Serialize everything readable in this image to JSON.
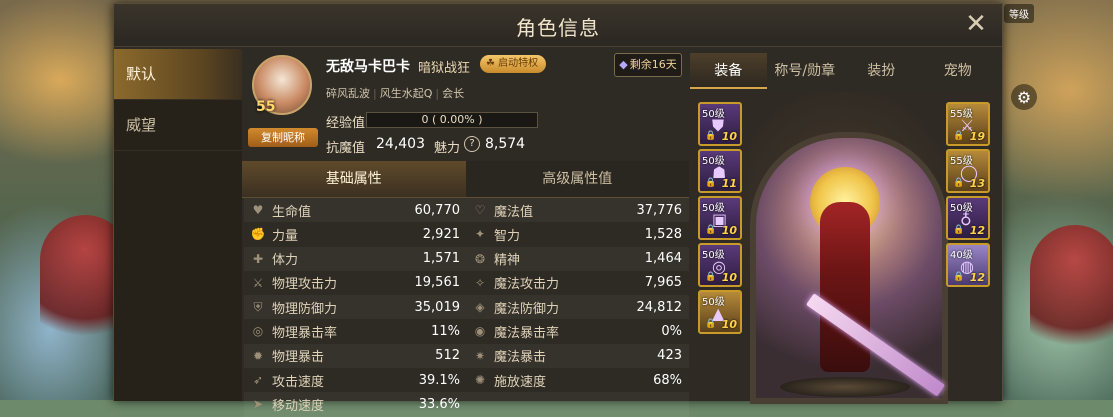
{
  "dialog": {
    "title": "角色信息",
    "close_icon": "close-icon"
  },
  "background": {
    "badge_text": "等级"
  },
  "side_nav": [
    {
      "label": "默认",
      "active": true
    },
    {
      "label": "威望",
      "active": false
    }
  ],
  "profile": {
    "level": "55",
    "copy_name_label": "复制昵称",
    "name": "无敌马卡巴卡",
    "title": "暗狱战狂",
    "privilege_label": "启动特权",
    "remaining_label": "剩余16天",
    "guild_name": "碎风乱波",
    "guild_server": "风生水起Q",
    "guild_role": "会长",
    "exp_label": "经验值",
    "exp_value": "0 ( 0.00% )",
    "exp_fraction": 0,
    "magic_resist_label": "抗魔值",
    "magic_resist_value": "24,403",
    "charm_label": "魅力",
    "charm_help": "?",
    "charm_value": "8,574"
  },
  "attr_tabs": [
    {
      "label": "基础属性",
      "active": true
    },
    {
      "label": "高级属性值",
      "active": false
    }
  ],
  "attributes": [
    [
      {
        "icon": "heart-icon",
        "label": "生命值",
        "value": "60,770"
      },
      {
        "icon": "magic-heart-icon",
        "label": "魔法值",
        "value": "37,776"
      }
    ],
    [
      {
        "icon": "strength-icon",
        "label": "力量",
        "value": "2,921"
      },
      {
        "icon": "intelligence-icon",
        "label": "智力",
        "value": "1,528"
      }
    ],
    [
      {
        "icon": "stamina-icon",
        "label": "体力",
        "value": "1,571"
      },
      {
        "icon": "spirit-icon",
        "label": "精神",
        "value": "1,464"
      }
    ],
    [
      {
        "icon": "sword-icon",
        "label": "物理攻击力",
        "value": "19,561"
      },
      {
        "icon": "magic-attack-icon",
        "label": "魔法攻击力",
        "value": "7,965"
      }
    ],
    [
      {
        "icon": "shield-icon",
        "label": "物理防御力",
        "value": "35,019"
      },
      {
        "icon": "magic-shield-icon",
        "label": "魔法防御力",
        "value": "24,812"
      }
    ],
    [
      {
        "icon": "crit-rate-icon",
        "label": "物理暴击率",
        "value": "11%"
      },
      {
        "icon": "magic-crit-rate-icon",
        "label": "魔法暴击率",
        "value": "0%"
      }
    ],
    [
      {
        "icon": "crit-icon",
        "label": "物理暴击",
        "value": "512"
      },
      {
        "icon": "magic-crit-icon",
        "label": "魔法暴击",
        "value": "423"
      }
    ],
    [
      {
        "icon": "attack-speed-icon",
        "label": "攻击速度",
        "value": "39.1%"
      },
      {
        "icon": "cast-speed-icon",
        "label": "施放速度",
        "value": "68%"
      }
    ],
    [
      {
        "icon": "move-speed-icon",
        "label": "移动速度",
        "value": "33.6%"
      },
      {
        "icon": "",
        "label": "",
        "value": ""
      }
    ]
  ],
  "right_tabs": [
    {
      "label": "装备",
      "active": true
    },
    {
      "label": "称号/勋章",
      "active": false
    },
    {
      "label": "装扮",
      "active": false
    },
    {
      "label": "宠物",
      "active": false
    }
  ],
  "equip_left": [
    {
      "level": "50级",
      "count": "10",
      "style": "purple",
      "icon": "armor-icon"
    },
    {
      "level": "50级",
      "count": "11",
      "style": "purple",
      "icon": "helmet-icon"
    },
    {
      "level": "50级",
      "count": "10",
      "style": "purple",
      "icon": "belt-icon"
    },
    {
      "level": "50级",
      "count": "10",
      "style": "purple",
      "icon": "spiral-icon"
    },
    {
      "level": "50级",
      "count": "10",
      "style": "gold",
      "icon": "boots-icon"
    }
  ],
  "equip_right": [
    {
      "level": "55级",
      "count": "19",
      "style": "gold",
      "icon": "weapon-icon"
    },
    {
      "level": "55级",
      "count": "13",
      "style": "gold",
      "icon": "ring-icon"
    },
    {
      "level": "50级",
      "count": "12",
      "style": "purple",
      "icon": "necklace-icon"
    },
    {
      "level": "40级",
      "count": "12",
      "style": "lav",
      "icon": "bracelet-icon"
    }
  ],
  "colors": {
    "accent_gold": "#d7a54b",
    "panel_bg": "#2e2a24",
    "count_yellow": "#ffd24a"
  }
}
